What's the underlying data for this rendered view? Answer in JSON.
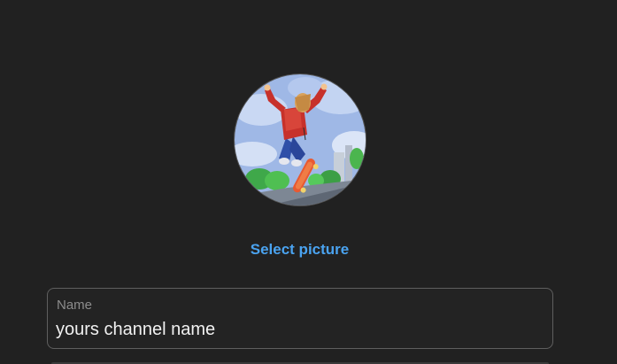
{
  "avatar": {
    "icon": "skateboarder-illustration"
  },
  "select_picture_label": "Select picture",
  "name_field": {
    "label": "Name",
    "value": "yours channel name"
  }
}
